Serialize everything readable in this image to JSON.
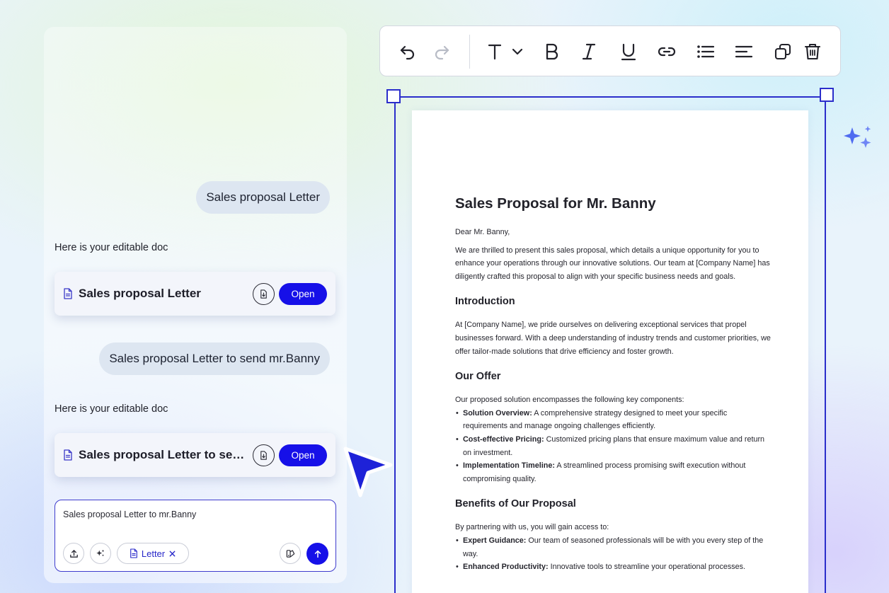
{
  "chat": {
    "messages": [
      {
        "role": "user",
        "text": "Sales proposal Letter"
      },
      {
        "role": "assistant",
        "text": "Here is your editable doc",
        "doc_title": "Sales proposal Letter",
        "open_label": "Open"
      },
      {
        "role": "user",
        "text": "Sales proposal Letter to send mr.Banny"
      },
      {
        "role": "assistant",
        "text": "Here is your editable doc",
        "doc_title": "Sales proposal Letter to send mr.Banny",
        "open_label": "Open"
      }
    ],
    "composer": {
      "value": "Sales proposal Letter to mr.Banny",
      "chip_label": "Letter"
    }
  },
  "toolbar": {
    "tools": [
      "undo",
      "redo",
      "text-style",
      "bold",
      "italic",
      "underline",
      "link",
      "bullet-list",
      "align-left",
      "duplicate",
      "delete"
    ]
  },
  "document": {
    "title": "Sales Proposal for Mr. Banny",
    "salutation": "Dear Mr. Banny,",
    "intro_paragraph": "We are thrilled to present this sales proposal, which details a unique opportunity for you to enhance your operations through our innovative solutions. Our team at [Company Name] has diligently crafted this proposal to align with your specific business needs and goals.",
    "sections": {
      "introduction": {
        "heading": "Introduction",
        "body": "At [Company Name], we pride ourselves on delivering exceptional services that propel businesses forward. With a deep understanding of industry trends and customer priorities, we offer tailor-made solutions that drive efficiency and foster growth."
      },
      "offer": {
        "heading": "Our Offer",
        "lead": "Our proposed solution encompasses the following key components:",
        "items": [
          {
            "term": "Solution Overview:",
            "text": " A comprehensive strategy designed to meet your specific requirements and manage ongoing challenges efficiently."
          },
          {
            "term": "Cost-effective Pricing:",
            "text": " Customized pricing plans that ensure maximum value and return on investment."
          },
          {
            "term": "Implementation Timeline:",
            "text": " A streamlined process promising swift execution without compromising quality."
          }
        ]
      },
      "benefits": {
        "heading": "Benefits of Our Proposal",
        "lead": "By partnering with us, you will gain access to:",
        "items": [
          {
            "term": "Expert Guidance:",
            "text": " Our team of seasoned professionals will be with you every step of the way."
          },
          {
            "term": "Enhanced Productivity:",
            "text": " Innovative tools to streamline your operational processes."
          }
        ]
      }
    }
  },
  "colors": {
    "accent": "#1610e8",
    "selection": "#2b2ecb",
    "bubble": "#dde6f1"
  }
}
